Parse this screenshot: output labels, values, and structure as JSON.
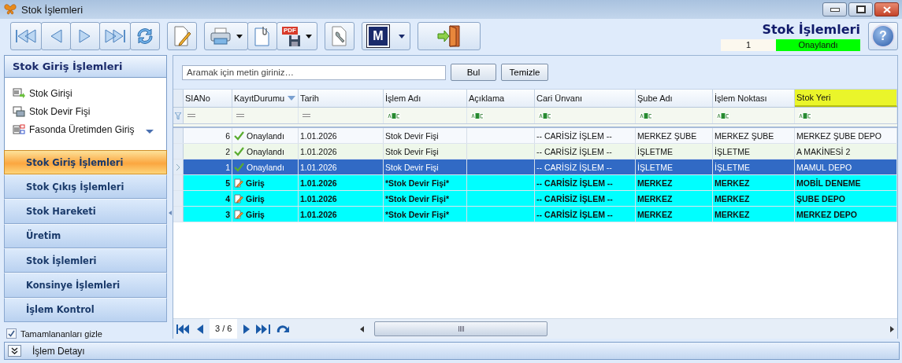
{
  "window": {
    "title": "Stok İşlemleri"
  },
  "toolbar": [
    {
      "kind": "first",
      "dropdown": false
    },
    {
      "kind": "prev",
      "dropdown": false
    },
    {
      "kind": "next",
      "dropdown": false
    },
    {
      "kind": "last",
      "dropdown": false
    },
    {
      "kind": "refresh",
      "dropdown": false
    },
    {
      "kind": "edit",
      "dropdown": false
    },
    {
      "kind": "print",
      "dropdown": true
    },
    {
      "kind": "attach",
      "dropdown": false
    },
    {
      "kind": "pdf",
      "dropdown": true,
      "label": "PDF"
    },
    {
      "kind": "tools",
      "dropdown": false
    },
    {
      "kind": "logo",
      "dropdown": true,
      "label": "M"
    },
    {
      "kind": "exit",
      "dropdown": false
    }
  ],
  "header": {
    "title": "Stok İşlemleri",
    "record_no": "1",
    "status": "Onaylandı"
  },
  "sidebar": {
    "title": "Stok Giriş İşlemleri",
    "items": [
      {
        "label": "Stok Girişi",
        "kind": "entry"
      },
      {
        "label": "Stok Devir Fişi",
        "kind": "transfer"
      },
      {
        "label": "Fasonda Üretimden Giriş",
        "kind": "production"
      }
    ],
    "groups": [
      {
        "label": "Stok Giriş İşlemleri",
        "selected": true
      },
      {
        "label": "Stok Çıkış İşlemleri",
        "selected": false
      },
      {
        "label": "Stok Hareketi",
        "selected": false
      },
      {
        "label": "Üretim",
        "selected": false
      },
      {
        "label": "Stok İşlemleri",
        "selected": false
      },
      {
        "label": "Konsinye İşlemleri",
        "selected": false
      },
      {
        "label": "İşlem Kontrol",
        "selected": false
      }
    ],
    "hide_completed": {
      "label": "Tamamlananları gizle",
      "checked": true
    }
  },
  "search": {
    "placeholder": "Aramak için metin giriniz…",
    "buttons": [
      "Bul",
      "Temizle"
    ]
  },
  "table": {
    "columns": [
      {
        "label": "SIANo",
        "kind": "equals",
        "sorted": false,
        "highlighted": false
      },
      {
        "label": "KayıtDurumu",
        "kind": "equals",
        "sorted": true,
        "highlighted": false
      },
      {
        "label": "Tarih",
        "kind": "equals",
        "sorted": false,
        "highlighted": false
      },
      {
        "label": "İşlem Adı",
        "kind": "text",
        "sorted": false,
        "highlighted": false
      },
      {
        "label": "Açıklama",
        "kind": "text",
        "sorted": false,
        "highlighted": false
      },
      {
        "label": "Cari Ünvanı",
        "kind": "text",
        "sorted": false,
        "highlighted": false
      },
      {
        "label": "Şube Adı",
        "kind": "text",
        "sorted": false,
        "highlighted": false
      },
      {
        "label": "İşlem Noktası",
        "kind": "text",
        "sorted": false,
        "highlighted": false
      },
      {
        "label": "Stok Yeri",
        "kind": "text",
        "sorted": false,
        "highlighted": true
      }
    ],
    "rows": [
      {
        "kind": "approved",
        "selected": false,
        "cells": [
          "6",
          "Onaylandı",
          "1.01.2026",
          "Stok Devir Fişi",
          "",
          "-- CARİSİZ İŞLEM --",
          "MERKEZ ŞUBE",
          "MERKEZ ŞUBE",
          "MERKEZ ŞUBE DEPO"
        ]
      },
      {
        "kind": "approved",
        "selected": false,
        "cells": [
          "2",
          "Onaylandı",
          "1.01.2026",
          "Stok Devir Fişi",
          "",
          "-- CARİSİZ İŞLEM --",
          "İŞLETME",
          "İŞLETME",
          "A MAKİNESİ 2"
        ]
      },
      {
        "kind": "approved",
        "selected": true,
        "cells": [
          "1",
          "Onaylandı",
          "1.01.2026",
          "Stok Devir Fişi",
          "",
          "-- CARİSİZ İŞLEM --",
          "İŞLETME",
          "İŞLETME",
          "MAMUL DEPO"
        ]
      },
      {
        "kind": "entry",
        "selected": false,
        "cells": [
          "5",
          "Giriş",
          "1.01.2026",
          "*Stok Devir Fişi*",
          "",
          "-- CARİSİZ İŞLEM --",
          "MERKEZ",
          "MERKEZ",
          "MOBİL DENEME"
        ]
      },
      {
        "kind": "entry",
        "selected": false,
        "cells": [
          "4",
          "Giriş",
          "1.01.2026",
          "*Stok Devir Fişi*",
          "",
          "-- CARİSİZ İŞLEM --",
          "MERKEZ",
          "MERKEZ",
          "ŞUBE DEPO"
        ]
      },
      {
        "kind": "entry",
        "selected": false,
        "cells": [
          "3",
          "Giriş",
          "1.01.2026",
          "*Stok Devir Fişi*",
          "",
          "-- CARİSİZ İŞLEM --",
          "MERKEZ",
          "MERKEZ",
          "MERKEZ DEPO"
        ]
      }
    ]
  },
  "pager": {
    "position": "3 / 6"
  },
  "help": {
    "label": "?"
  },
  "detail_panel": {
    "label": "İşlem Detayı"
  }
}
